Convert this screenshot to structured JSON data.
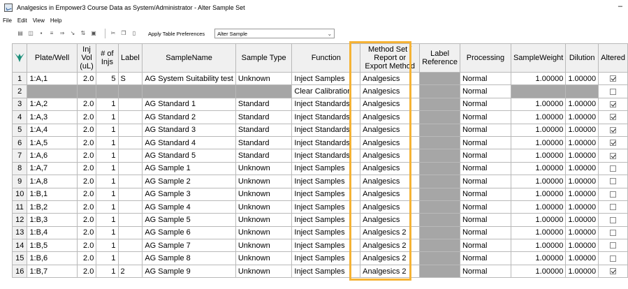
{
  "window": {
    "title": "Analgesics in Empower3 Course Data as System/Administrator - Alter Sample Set",
    "minimize": "–"
  },
  "menu": [
    "File",
    "Edit",
    "View",
    "Help"
  ],
  "toolbar": {
    "apply_button": "Apply Table Preferences",
    "preference_value": "Alter Sample"
  },
  "table": {
    "columns": [
      "Plate/Well",
      "Inj Vol (uL)",
      "# of Injs",
      "Label",
      "SampleName",
      "Sample Type",
      "Function",
      "Method Set / Report or Export Method",
      "Label Reference",
      "Processing",
      "SampleWeight",
      "Dilution",
      "Altered"
    ],
    "rows": [
      {
        "n": "1",
        "plate": "1:A,1",
        "vol": "2.0",
        "injs": "5",
        "label": "S",
        "name": "AG System Suitability test",
        "type": "Unknown",
        "func": "Inject Samples",
        "method": "Analgesics",
        "proc": "Normal",
        "weight": "1.00000",
        "dil": "1.00000",
        "altered": true
      },
      {
        "n": "2",
        "plate": "",
        "vol": "",
        "injs": "",
        "label": "",
        "name": "",
        "type": "",
        "func": "Clear Calibration",
        "method": "Analgesics",
        "proc": "Normal",
        "weight": "",
        "dil": "",
        "altered": false,
        "gray": true
      },
      {
        "n": "3",
        "plate": "1:A,2",
        "vol": "2.0",
        "injs": "1",
        "label": "",
        "name": "AG Standard 1",
        "type": "Standard",
        "func": "Inject Standards",
        "method": "Analgesics",
        "proc": "Normal",
        "weight": "1.00000",
        "dil": "1.00000",
        "altered": true
      },
      {
        "n": "4",
        "plate": "1:A,3",
        "vol": "2.0",
        "injs": "1",
        "label": "",
        "name": "AG Standard 2",
        "type": "Standard",
        "func": "Inject Standards",
        "method": "Analgesics",
        "proc": "Normal",
        "weight": "1.00000",
        "dil": "1.00000",
        "altered": true
      },
      {
        "n": "5",
        "plate": "1:A,4",
        "vol": "2.0",
        "injs": "1",
        "label": "",
        "name": "AG Standard 3",
        "type": "Standard",
        "func": "Inject Standards",
        "method": "Analgesics",
        "proc": "Normal",
        "weight": "1.00000",
        "dil": "1.00000",
        "altered": true
      },
      {
        "n": "6",
        "plate": "1:A,5",
        "vol": "2.0",
        "injs": "1",
        "label": "",
        "name": "AG Standard 4",
        "type": "Standard",
        "func": "Inject Standards",
        "method": "Analgesics",
        "proc": "Normal",
        "weight": "1.00000",
        "dil": "1.00000",
        "altered": true
      },
      {
        "n": "7",
        "plate": "1:A,6",
        "vol": "2.0",
        "injs": "1",
        "label": "",
        "name": "AG Standard 5",
        "type": "Standard",
        "func": "Inject Standards",
        "method": "Analgesics",
        "proc": "Normal",
        "weight": "1.00000",
        "dil": "1.00000",
        "altered": true
      },
      {
        "n": "8",
        "plate": "1:A,7",
        "vol": "2.0",
        "injs": "1",
        "label": "",
        "name": "AG Sample 1",
        "type": "Unknown",
        "func": "Inject Samples",
        "method": "Analgesics",
        "proc": "Normal",
        "weight": "1.00000",
        "dil": "1.00000",
        "altered": false
      },
      {
        "n": "9",
        "plate": "1:A,8",
        "vol": "2.0",
        "injs": "1",
        "label": "",
        "name": "AG Sample 2",
        "type": "Unknown",
        "func": "Inject Samples",
        "method": "Analgesics",
        "proc": "Normal",
        "weight": "1.00000",
        "dil": "1.00000",
        "altered": false
      },
      {
        "n": "10",
        "plate": "1:B,1",
        "vol": "2.0",
        "injs": "1",
        "label": "",
        "name": "AG Sample 3",
        "type": "Unknown",
        "func": "Inject Samples",
        "method": "Analgesics",
        "proc": "Normal",
        "weight": "1.00000",
        "dil": "1.00000",
        "altered": false
      },
      {
        "n": "11",
        "plate": "1:B,2",
        "vol": "2.0",
        "injs": "1",
        "label": "",
        "name": "AG Sample 4",
        "type": "Unknown",
        "func": "Inject Samples",
        "method": "Analgesics",
        "proc": "Normal",
        "weight": "1.00000",
        "dil": "1.00000",
        "altered": false
      },
      {
        "n": "12",
        "plate": "1:B,3",
        "vol": "2.0",
        "injs": "1",
        "label": "",
        "name": "AG Sample 5",
        "type": "Unknown",
        "func": "Inject Samples",
        "method": "Analgesics",
        "proc": "Normal",
        "weight": "1.00000",
        "dil": "1.00000",
        "altered": false
      },
      {
        "n": "13",
        "plate": "1:B,4",
        "vol": "2.0",
        "injs": "1",
        "label": "",
        "name": "AG Sample 6",
        "type": "Unknown",
        "func": "Inject Samples",
        "method": "Analgesics 2",
        "proc": "Normal",
        "weight": "1.00000",
        "dil": "1.00000",
        "altered": false
      },
      {
        "n": "14",
        "plate": "1:B,5",
        "vol": "2.0",
        "injs": "1",
        "label": "",
        "name": "AG Sample 7",
        "type": "Unknown",
        "func": "Inject Samples",
        "method": "Analgesics 2",
        "proc": "Normal",
        "weight": "1.00000",
        "dil": "1.00000",
        "altered": false
      },
      {
        "n": "15",
        "plate": "1:B,6",
        "vol": "2.0",
        "injs": "1",
        "label": "",
        "name": "AG Sample 8",
        "type": "Unknown",
        "func": "Inject Samples",
        "method": "Analgesics 2",
        "proc": "Normal",
        "weight": "1.00000",
        "dil": "1.00000",
        "altered": false
      },
      {
        "n": "16",
        "plate": "1:B,7",
        "vol": "2.0",
        "injs": "1",
        "label": "2",
        "name": "AG Sample 9",
        "type": "Unknown",
        "func": "Inject Samples",
        "method": "Analgesics 2",
        "proc": "Normal",
        "weight": "1.00000",
        "dil": "1.00000",
        "altered": true
      }
    ]
  },
  "colors": {
    "highlight": "#f5b335",
    "gray_cell": "#a6a6a6",
    "logo": "#1a8f7a"
  }
}
